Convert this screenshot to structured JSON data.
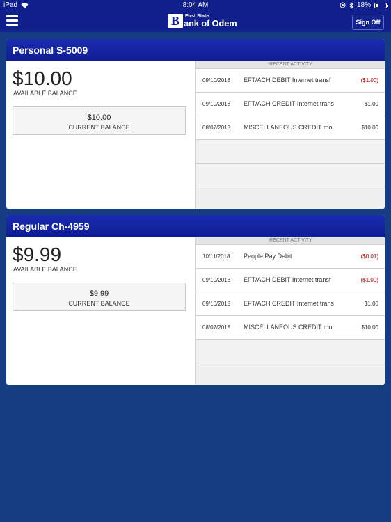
{
  "status_bar": {
    "carrier": "iPad",
    "time": "8:04 AM",
    "battery": "18%"
  },
  "nav": {
    "logo_top": "First State",
    "logo_letter": "B",
    "logo_bottom": "ank of Odem",
    "sign_off": "Sign Off"
  },
  "accounts": [
    {
      "name": "Personal S-5009",
      "available_amount": "$10.00",
      "available_label": "AVAILABLE BALANCE",
      "current_amount": "$10.00",
      "current_label": "CURRENT BALANCE",
      "activity_header": "RECENT ACTIVITY",
      "activity": [
        {
          "date": "09/10/2018",
          "desc": "EFT/ACH DEBIT Internet transf",
          "amount": "($1.00)"
        },
        {
          "date": "09/10/2018",
          "desc": "EFT/ACH CREDIT Internet trans",
          "amount": "$1.00"
        },
        {
          "date": "08/07/2018",
          "desc": "MISCELLANEOUS CREDIT mo",
          "amount": "$10.00"
        }
      ]
    },
    {
      "name": "Regular Ch-4959",
      "available_amount": "$9.99",
      "available_label": "AVAILABLE BALANCE",
      "current_amount": "$9.99",
      "current_label": "CURRENT BALANCE",
      "activity_header": "RECENT ACTIVITY",
      "activity": [
        {
          "date": "10/11/2018",
          "desc": "People Pay Debit",
          "amount": "($0.01)"
        },
        {
          "date": "09/10/2018",
          "desc": "EFT/ACH DEBIT Internet transf",
          "amount": "($1.00)"
        },
        {
          "date": "09/10/2018",
          "desc": "EFT/ACH CREDIT Internet trans",
          "amount": "$1.00"
        },
        {
          "date": "08/07/2018",
          "desc": "MISCELLANEOUS CREDIT mo",
          "amount": "$10.00"
        }
      ]
    }
  ],
  "colors": {
    "nav_bg": "#0f1f8c",
    "page_bg": "#163d82",
    "card_header": "#1424a2",
    "negative": "#b30000"
  }
}
